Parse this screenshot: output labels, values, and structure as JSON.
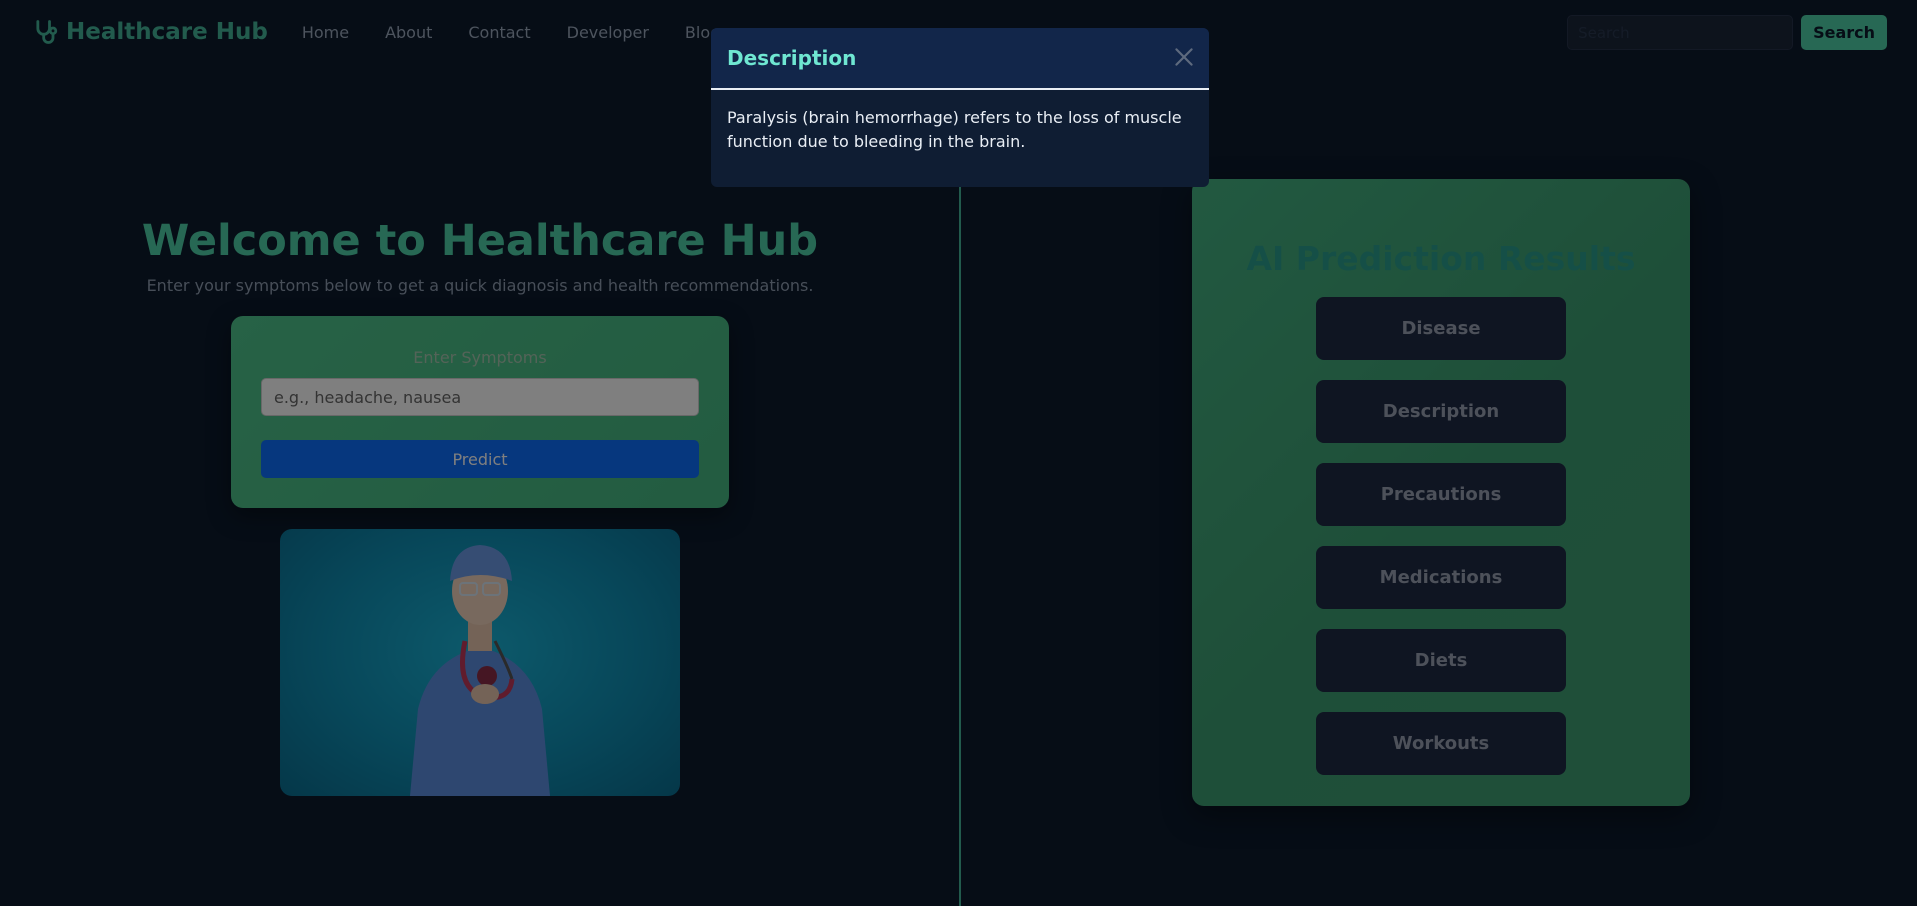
{
  "nav": {
    "brand": "Healthcare Hub",
    "links": [
      "Home",
      "About",
      "Contact",
      "Developer",
      "Blog"
    ],
    "search_placeholder": "Search",
    "search_button": "Search"
  },
  "hero": {
    "title": "Welcome to Healthcare Hub",
    "subtitle": "Enter your symptoms below to get a quick diagnosis and health recommendations."
  },
  "symptom_form": {
    "label": "Enter Symptoms",
    "placeholder": "e.g., headache, nausea",
    "predict_label": "Predict"
  },
  "results": {
    "title": "AI Prediction Results",
    "buttons": [
      "Disease",
      "Description",
      "Precautions",
      "Medications",
      "Diets",
      "Workouts"
    ]
  },
  "modal": {
    "title": "Description",
    "body": "Paralysis (brain hemorrhage) refers to the loss of muscle function due to bleeding in the brain."
  },
  "colors": {
    "accent": "#4fd1a8",
    "background": "#0c1a2c",
    "predict": "#0d6efd"
  }
}
